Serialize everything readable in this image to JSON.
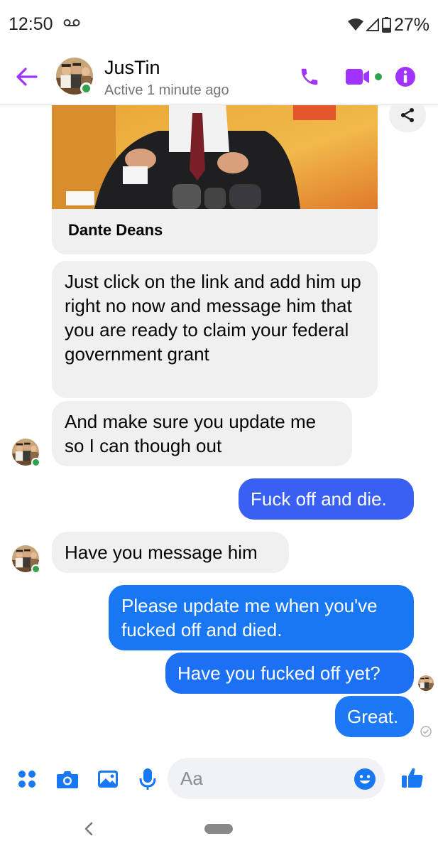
{
  "status_bar": {
    "time": "12:50",
    "battery_percent": "27%",
    "icons": [
      "voicemail-icon",
      "wifi-icon",
      "cell-signal-icon",
      "battery-icon"
    ]
  },
  "header": {
    "contact_name": "JusTin",
    "presence": "Active 1 minute ago",
    "accent_color": "#a033ff",
    "online_color": "#31a24c",
    "icons": [
      "back-arrow-icon",
      "phone-icon",
      "video-camera-icon",
      "info-icon"
    ]
  },
  "conversation": {
    "link_preview": {
      "title": "Dante Deans"
    },
    "messages": [
      {
        "direction": "incoming",
        "text": "Just click on the link and add him up right no now and message him that you are ready to claim your federal government grant"
      },
      {
        "direction": "incoming",
        "text": "And make sure you update me so I can though out"
      },
      {
        "direction": "outgoing",
        "text": "Fuck off and die."
      },
      {
        "direction": "incoming",
        "text": "Have you message him"
      },
      {
        "direction": "outgoing",
        "text": "Please update me when you've fucked off and died."
      },
      {
        "direction": "outgoing",
        "text": "Have you fucked off yet?"
      },
      {
        "direction": "outgoing",
        "text": "Great."
      }
    ],
    "outgoing_color": "#1877f2",
    "incoming_color": "#f0f0f0"
  },
  "composer": {
    "placeholder": "Aa",
    "accent_color": "#1877f2",
    "icons": [
      "more-apps-icon",
      "camera-icon",
      "gallery-icon",
      "microphone-icon",
      "emoji-icon",
      "thumbs-up-icon"
    ]
  },
  "nav_bar": {
    "icons": [
      "nav-back-icon",
      "home-pill-icon"
    ]
  }
}
